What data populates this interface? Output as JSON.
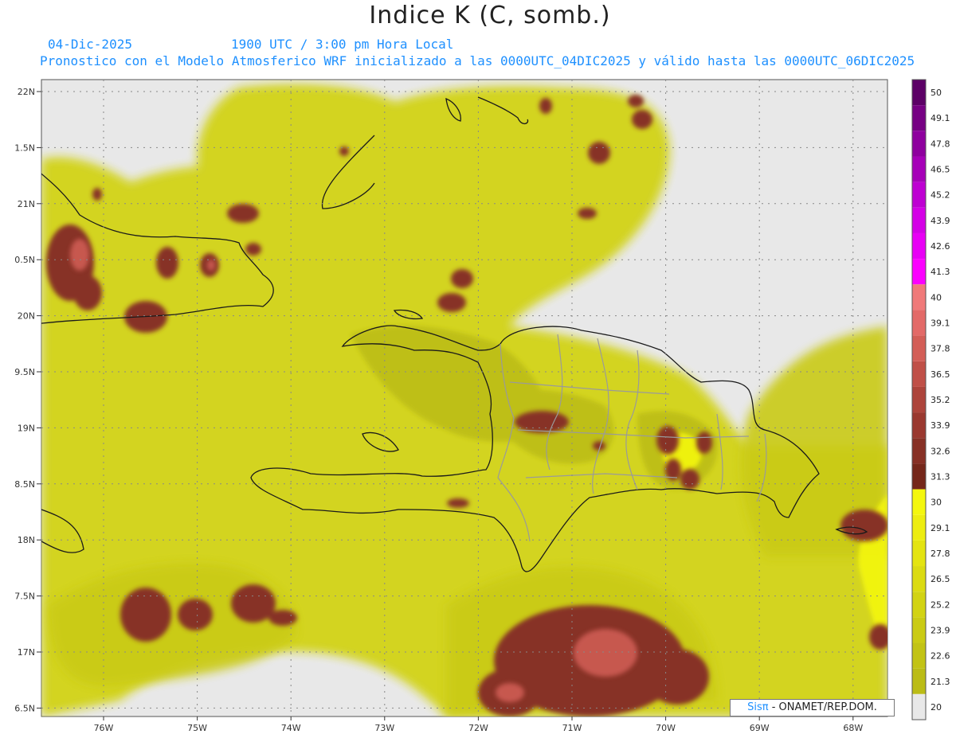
{
  "title": "Indice K (C, somb.)",
  "date_label": "04-Dic-2025",
  "time_label": "1900 UTC / 3:00 pm Hora Local",
  "model_label": "Pronostico con el Modelo Atmosferico WRF inicializado a las 0000UTC_04DIC2025 y válido hasta las  0000UTC_06DIC2025",
  "credit": {
    "brand": "Sisπ",
    "org": " - ONAMET/REP.DOM."
  },
  "map": {
    "region": "Hispaniola / Greater Antilles",
    "lon_ticks": [
      "76W",
      "75W",
      "74W",
      "73W",
      "72W",
      "71W",
      "70W",
      "69W",
      "68W"
    ],
    "lat_ticks": [
      "22N",
      "1.5N",
      "21N",
      "0.5N",
      "20N",
      "9.5N",
      "19N",
      "8.5N",
      "18N",
      "7.5N",
      "17N",
      "6.5N"
    ],
    "colors": {
      "background": "#e8e8e8",
      "coast": "#1a1a1a",
      "borders": "#9a9a9a",
      "grid": "#888888"
    }
  },
  "colorbar": {
    "levels": [
      "50",
      "49.1",
      "47.8",
      "46.5",
      "45.2",
      "43.9",
      "42.6",
      "41.3",
      "40",
      "39.1",
      "37.8",
      "36.5",
      "35.2",
      "33.9",
      "32.6",
      "31.3",
      "30",
      "29.1",
      "27.8",
      "26.5",
      "25.2",
      "23.9",
      "22.6",
      "21.3",
      "20"
    ],
    "colors": [
      "#5c0066",
      "#760083",
      "#8e009e",
      "#a600b8",
      "#be00d2",
      "#d400e6",
      "#e800f5",
      "#fb00ff",
      "#f07a7a",
      "#e36a68",
      "#d35e57",
      "#c05048",
      "#ad443b",
      "#9a382f",
      "#873025",
      "#75271a",
      "#f4f70e",
      "#eded10",
      "#e4e411",
      "#dbdb12",
      "#d2d313",
      "#cacb14",
      "#c2c315",
      "#bbbc16",
      "#e8e8e8"
    ]
  }
}
